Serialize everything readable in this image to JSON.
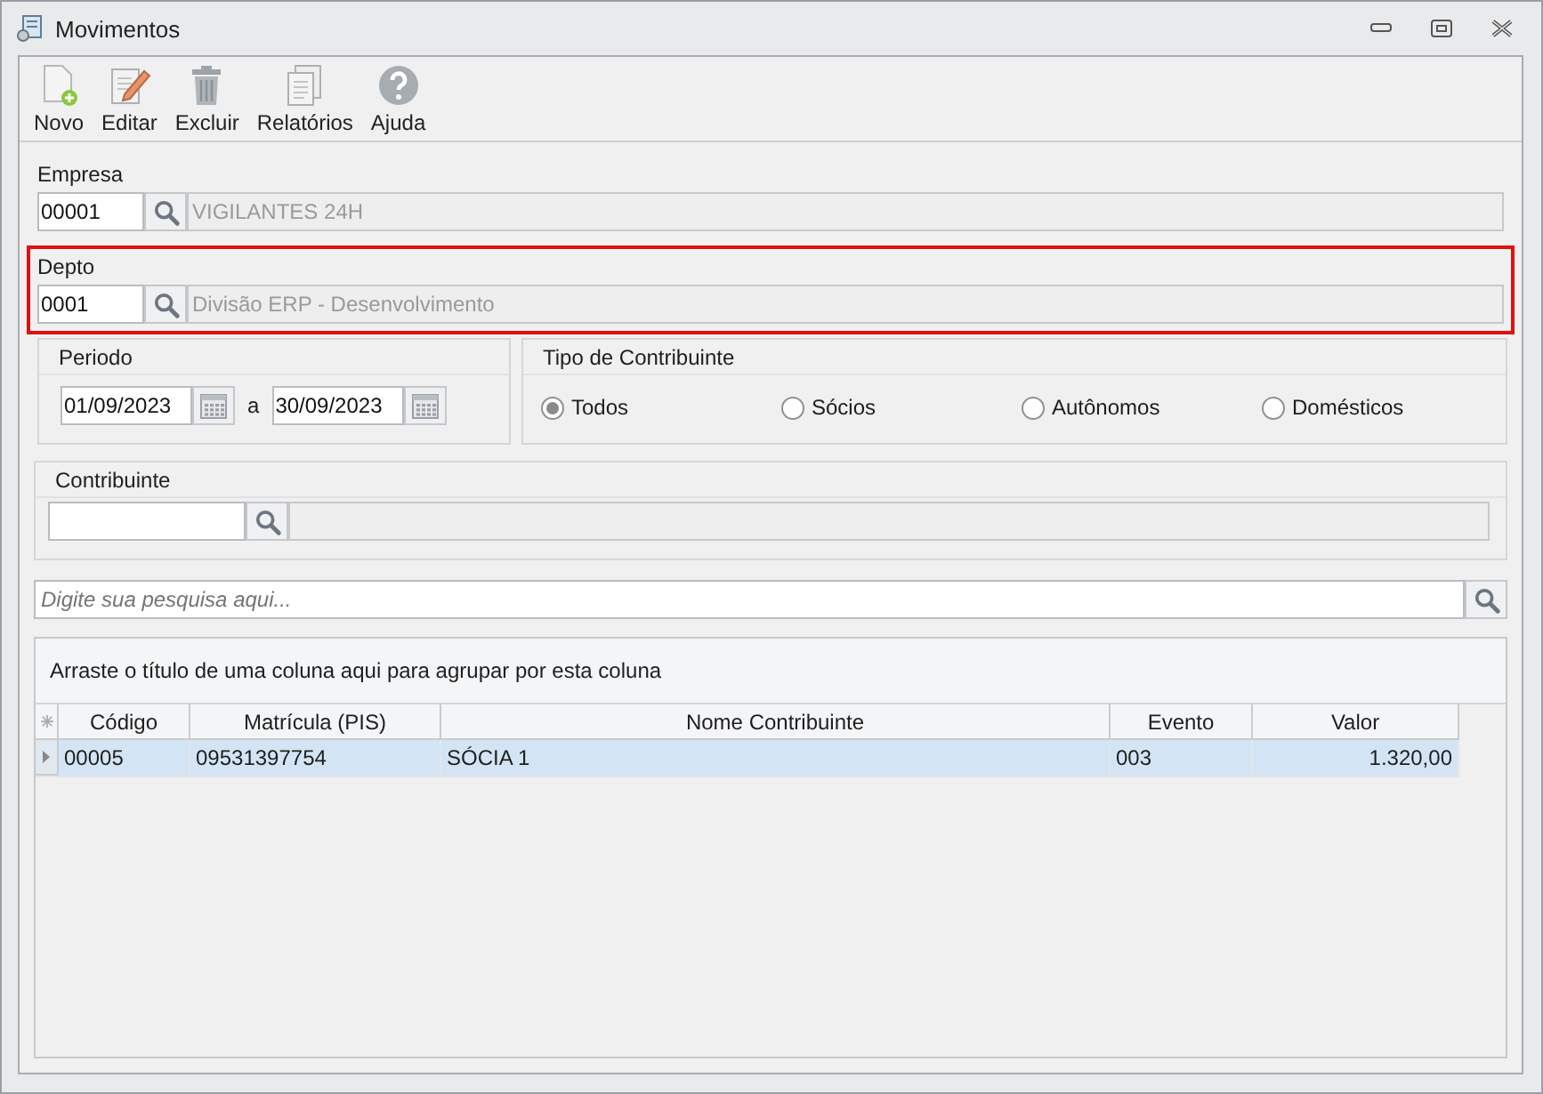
{
  "window": {
    "title": "Movimentos"
  },
  "toolbar": [
    {
      "label": "Novo",
      "kind": "new"
    },
    {
      "label": "Editar",
      "kind": "edit"
    },
    {
      "label": "Excluir",
      "kind": "delete"
    },
    {
      "label": "Relatórios",
      "kind": "report"
    },
    {
      "label": "Ajuda",
      "kind": "help"
    }
  ],
  "empresa": {
    "label": "Empresa",
    "code": "00001",
    "name": "VIGILANTES 24H",
    "highlighted": false
  },
  "depto": {
    "label": "Depto",
    "code": "0001",
    "name": "Divisão ERP - Desenvolvimento",
    "highlighted": true
  },
  "periodo": {
    "title": "Periodo",
    "from": "01/09/2023",
    "separator": "a",
    "to": "30/09/2023"
  },
  "tipo_contribuinte": {
    "title": "Tipo de Contribuinte",
    "options": [
      {
        "label": "Todos",
        "selected": true
      },
      {
        "label": "Sócios",
        "selected": false
      },
      {
        "label": "Autônomos",
        "selected": false
      },
      {
        "label": "Domésticos",
        "selected": false
      }
    ]
  },
  "contribuinte": {
    "title": "Contribuinte"
  },
  "search": {
    "placeholder": "Digite sua pesquisa aqui..."
  },
  "grid": {
    "group_hint": "Arraste o título de uma coluna aqui para agrupar por esta coluna",
    "columns": [
      "Código",
      "Matrícula (PIS)",
      "Nome Contribuinte",
      "Evento",
      "Valor"
    ],
    "rows": [
      {
        "cells": [
          "00005",
          "09531397754",
          "SÓCIA 1",
          "003",
          "1.320,00"
        ],
        "selected": true
      }
    ]
  }
}
